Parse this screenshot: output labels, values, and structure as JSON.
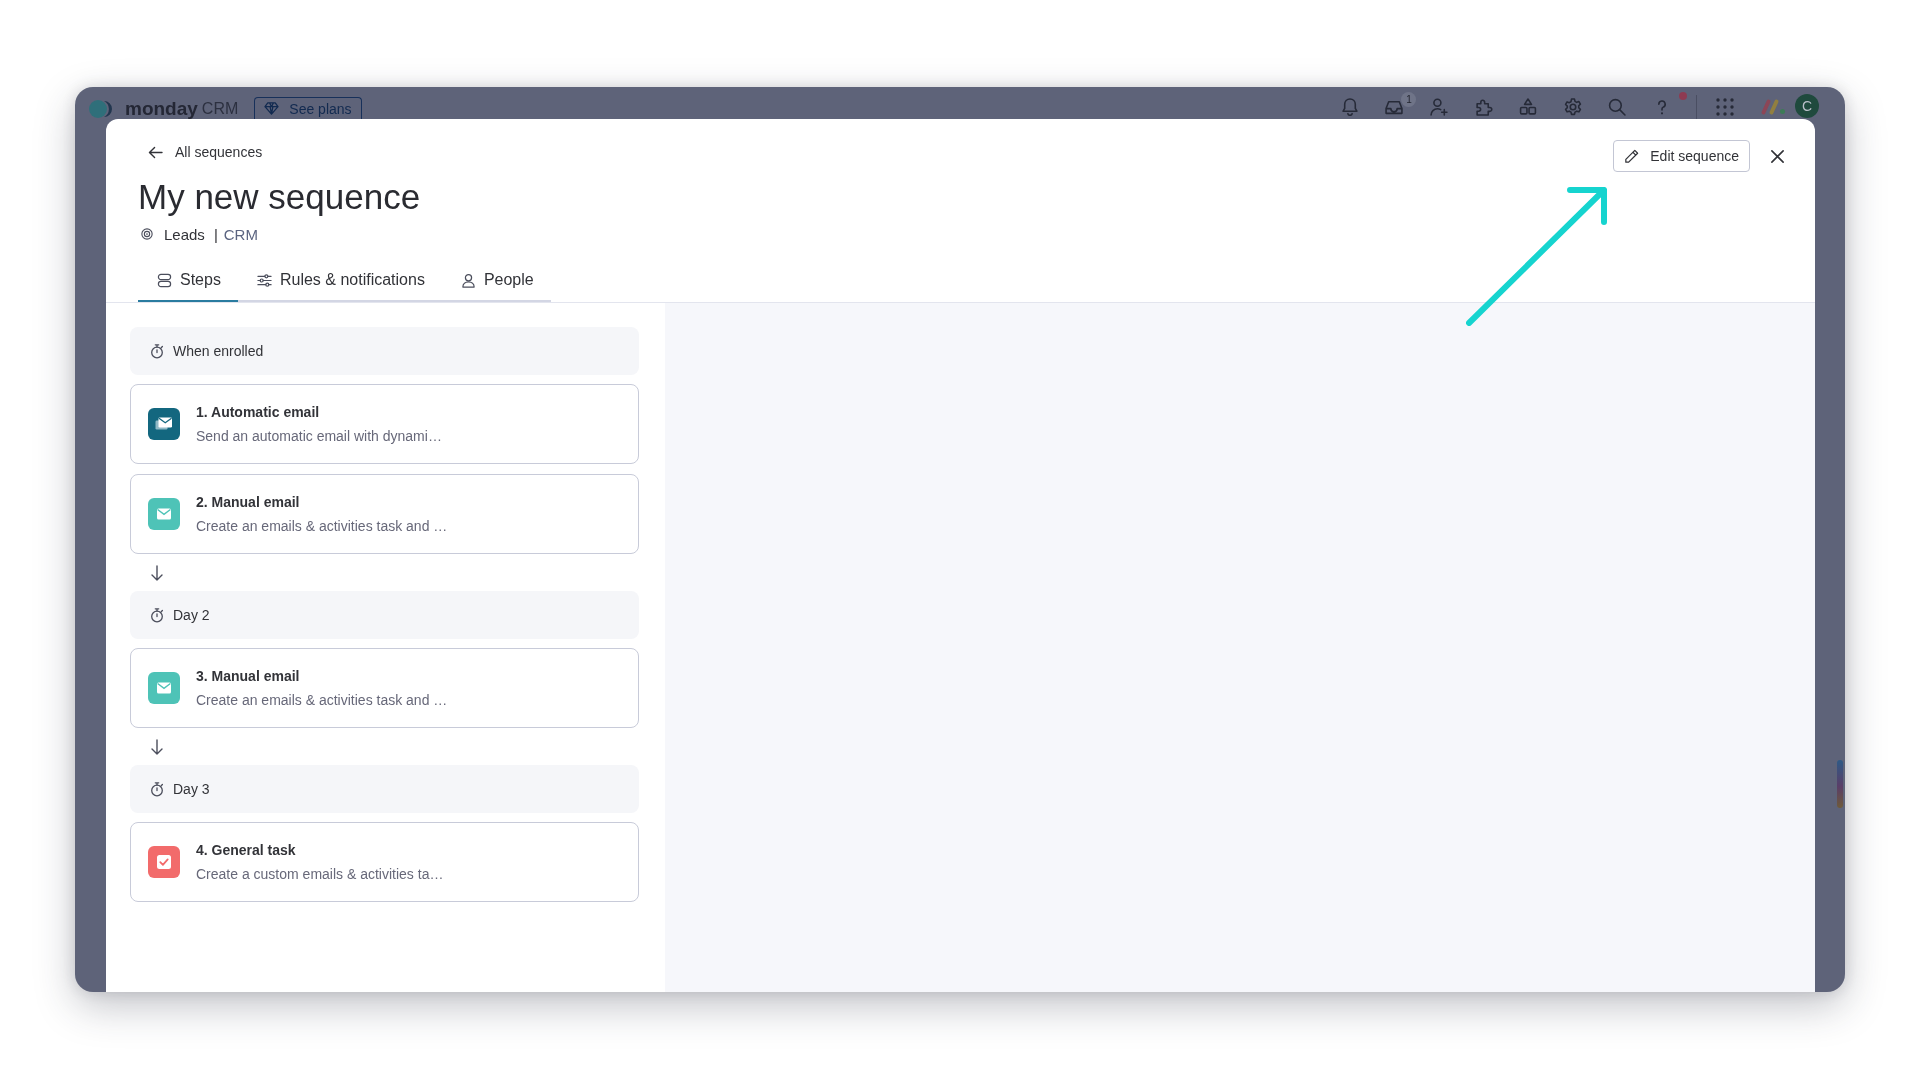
{
  "app_bar": {
    "brand": "monday",
    "product": "CRM",
    "plans_button": "See plans",
    "tools": [
      {
        "kind": "notifications",
        "alert": false
      },
      {
        "kind": "inbox",
        "alert": false,
        "badge": "1"
      },
      {
        "kind": "invite",
        "alert": false
      },
      {
        "kind": "integrations",
        "alert": false
      },
      {
        "kind": "marketplace",
        "alert": false
      },
      {
        "kind": "settings",
        "alert": false
      },
      {
        "kind": "search",
        "alert": false
      },
      {
        "kind": "help",
        "alert": true
      }
    ],
    "avatar_initial": "C"
  },
  "sequence": {
    "back_link": "All sequences",
    "title": "My new sequence",
    "board": "Leads",
    "separator": "|",
    "workspace": "CRM",
    "edit_button": "Edit sequence"
  },
  "tabs": [
    {
      "kind": "steps",
      "label": "Steps",
      "selected": true
    },
    {
      "kind": "rules",
      "label": "Rules & notifications",
      "selected": false
    },
    {
      "kind": "people",
      "label": "People",
      "selected": false
    }
  ],
  "schedule": [
    {
      "label": "When enrolled",
      "steps": [
        {
          "kind": "automatic",
          "title": "1. Automatic email",
          "description": "Send an automatic email with dynami…"
        },
        {
          "kind": "manual",
          "title": "2. Manual email",
          "description": "Create an emails & activities task and …"
        }
      ]
    },
    {
      "label": "Day 2",
      "steps": [
        {
          "kind": "manual",
          "title": "3. Manual email",
          "description": "Create an emails & activities task and …"
        }
      ]
    },
    {
      "label": "Day 3",
      "steps": [
        {
          "kind": "task",
          "title": "4. General task",
          "description": "Create a custom emails & activities ta…"
        }
      ]
    }
  ]
}
